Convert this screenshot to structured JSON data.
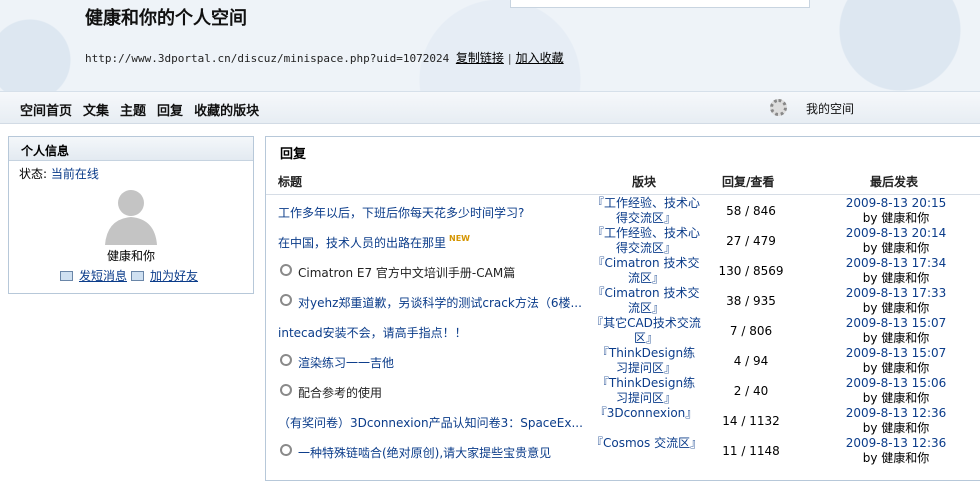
{
  "header": {
    "title": "健康和你的个人空间",
    "url": "http://www.3dportal.cn/discuz/minispace.php?uid=1072024",
    "copy_link": "复制链接",
    "separator": "|",
    "add_fav": "加入收藏"
  },
  "nav": {
    "items": [
      "空间首页",
      "文集",
      "主题",
      "回复",
      "收藏的版块"
    ],
    "my_space": "我的空间"
  },
  "profile": {
    "heading": "个人信息",
    "status_label": "状态:",
    "status_value": "当前在线",
    "username": "健康和你",
    "send_msg": "发短消息",
    "add_friend": "加为好友"
  },
  "replies": {
    "heading": "回复",
    "columns": [
      "标题",
      "版块",
      "回复/查看",
      "最后发表"
    ],
    "rows": [
      {
        "title": "工作多年以后，下班后你每天花多少时间学习?",
        "clip": false,
        "new": false,
        "forum": "『工作经验、技术心得交流区』",
        "stats": "58 / 846",
        "date": "2009-8-13 20:15",
        "by": "by 健康和你"
      },
      {
        "title": "在中国，技术人员的出路在那里",
        "clip": false,
        "new": true,
        "new_label": "NEW",
        "forum": "『工作经验、技术心得交流区』",
        "stats": "27 / 479",
        "date": "2009-8-13 20:14",
        "by": "by 健康和你"
      },
      {
        "title": "Cimatron E7 官方中文培训手册-CAM篇",
        "clip": true,
        "new": false,
        "forum": "『Cimatron 技术交流区』",
        "stats": "130 / 8569",
        "date": "2009-8-13 17:34",
        "by": "by 健康和你"
      },
      {
        "title": "对yehz郑重道歉，另谈科学的测试crack方法（6楼...",
        "clip": true,
        "new": false,
        "forum": "『Cimatron 技术交流区』",
        "stats": "38 / 935",
        "date": "2009-8-13 17:33",
        "by": "by 健康和你"
      },
      {
        "title": "intecad安装不会，请高手指点！！",
        "clip": false,
        "new": false,
        "forum": "『其它CAD技术交流区』",
        "stats": "7 / 806",
        "date": "2009-8-13 15:07",
        "by": "by 健康和你"
      },
      {
        "title": "渲染练习一一吉他",
        "clip": true,
        "new": false,
        "forum": "『ThinkDesign练习提问区』",
        "stats": "4 / 94",
        "date": "2009-8-13 15:07",
        "by": "by 健康和你"
      },
      {
        "title": "配合参考的使用",
        "clip": true,
        "new": false,
        "forum": "『ThinkDesign练习提问区』",
        "stats": "2 / 40",
        "date": "2009-8-13 15:06",
        "by": "by 健康和你"
      },
      {
        "title": "（有奖问卷）3Dconnexion产品认知问卷3：SpaceEx...",
        "clip": false,
        "new": false,
        "forum": "『3Dconnexion』",
        "stats": "14 / 1132",
        "date": "2009-8-13 12:36",
        "by": "by 健康和你"
      },
      {
        "title": "一种特殊链啮合(绝对原创),请大家提些宝贵意见",
        "clip": true,
        "new": false,
        "forum": "『Cosmos 交流区』",
        "stats": "11 / 1148",
        "date": "2009-8-13 12:36",
        "by": "by 健康和你"
      }
    ]
  }
}
